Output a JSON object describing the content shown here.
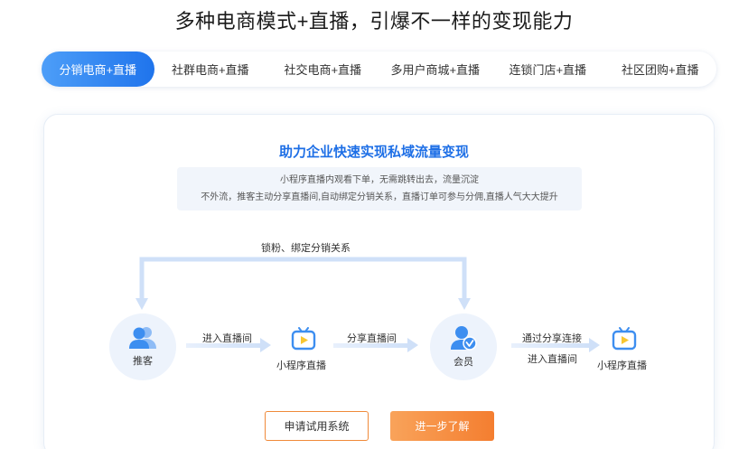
{
  "headline": "多种电商模式+直播，引爆不一样的变现能力",
  "tabs": [
    {
      "label": "分销电商+直播",
      "active": true
    },
    {
      "label": "社群电商+直播",
      "active": false
    },
    {
      "label": "社交电商+直播",
      "active": false
    },
    {
      "label": "多用户商城+直播",
      "active": false
    },
    {
      "label": "连锁门店+直播",
      "active": false
    },
    {
      "label": "社区团购+直播",
      "active": false
    }
  ],
  "card": {
    "title": "助力企业快速实现私域流量变现",
    "desc_line1": "小程序直播内观看下单，无需跳转出去，流量沉淀",
    "desc_line2": "不外流，推客主动分享直播间,自动绑定分销关系，直播订单可参与分佣,直播人气大大提升"
  },
  "flow": {
    "loop_label": "锁粉、绑定分销关系",
    "node_promoter": "推客",
    "step1": "进入直播间",
    "node_mini_live_1": "小程序直播",
    "step2": "分享直播间",
    "node_member": "会员",
    "step3_line1": "通过分享连接",
    "step3_line2": "进入直播间",
    "node_mini_live_2": "小程序直播"
  },
  "buttons": {
    "trial": "申请试用系统",
    "learn_more": "进一步了解"
  },
  "colors": {
    "accent_blue": "#1f74ec",
    "accent_orange": "#f47e30",
    "icon_blue": "#3d8ef0",
    "icon_yellow": "#f8c631"
  },
  "icons": {
    "promoter": "users-icon",
    "member": "verified-user-icon",
    "mini_live": "tv-play-icon"
  }
}
